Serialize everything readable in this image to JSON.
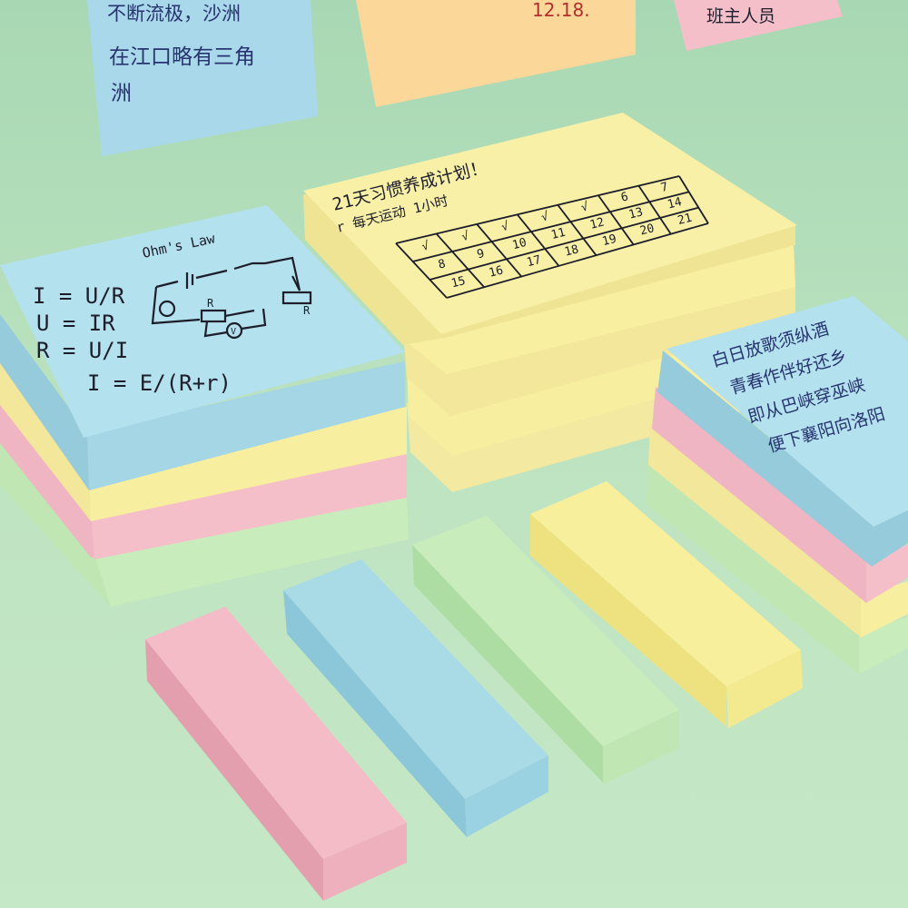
{
  "colors": {
    "background": "#bfe3c3",
    "pastel_blue": "#a9dbe7",
    "pastel_yellow": "#f7f0a8",
    "pastel_pink": "#f3b8c3",
    "pastel_green": "#c4ebbb",
    "pastel_orange": "#fcd79a",
    "ink_blue": "#27346f",
    "ink_black": "#1d1d2b"
  },
  "wall_notes": {
    "blue_note": {
      "line1": "不断流极，沙洲",
      "line2": "在江口略有三角",
      "line3": "洲"
    },
    "orange_note": {
      "date": "12.18."
    },
    "pink_note": {
      "text": "班主人员"
    }
  },
  "ohms_law_pad": {
    "title": "Ohm's Law",
    "eq1": "I = U/R",
    "eq2": "U = IR",
    "eq3": "R = U/I",
    "eq4": "I = E/(R+r)",
    "resistor_label": "R",
    "resistor_label_2": "R",
    "voltmeter_label": "V"
  },
  "calendar_pad": {
    "title": "21天习惯养成计划！",
    "subtitle": "r 每天运动 1小时",
    "cells": [
      "√",
      "√",
      "√",
      "√",
      "√",
      "6",
      "7",
      "8",
      "9",
      "10",
      "11",
      "12",
      "13",
      "14",
      "15",
      "16",
      "17",
      "18",
      "19",
      "20",
      "21"
    ]
  },
  "poem_pad": {
    "line1": "白日放歌须纵酒",
    "line2": "青春作伴好还乡",
    "line3": "即从巴峡穿巫峡",
    "line4": "便下襄阳向洛阳"
  }
}
